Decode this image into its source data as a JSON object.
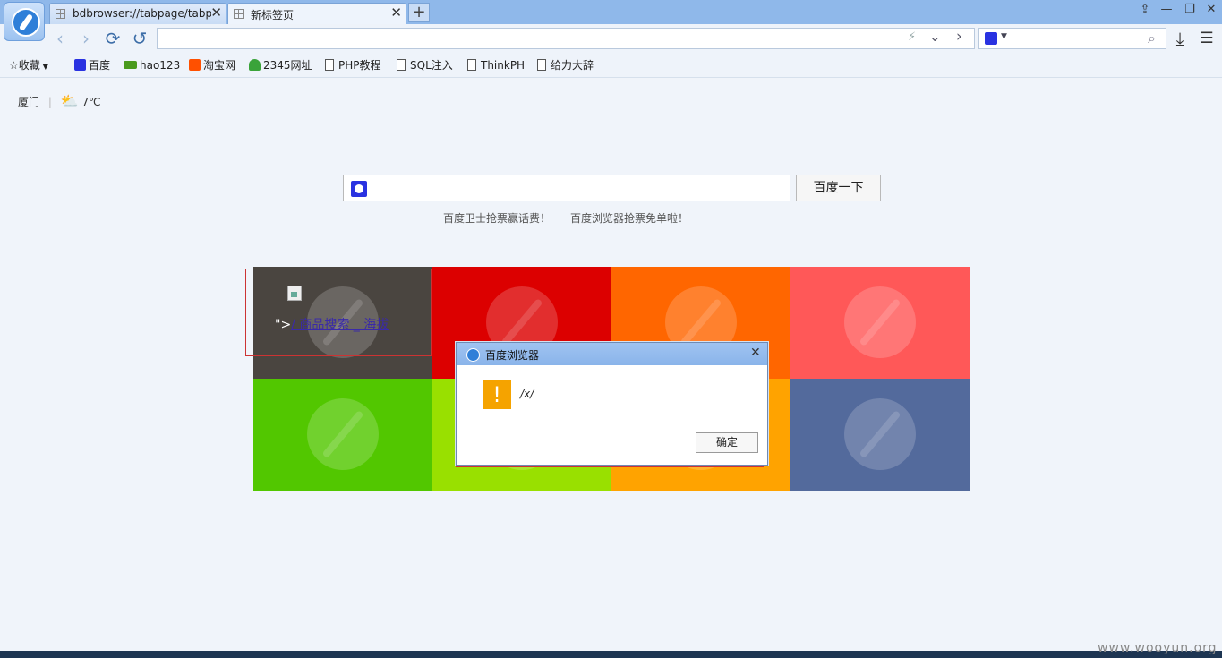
{
  "tabs": [
    {
      "title": "bdbrowser://tabpage/tabpa",
      "active": false
    },
    {
      "title": "新标签页",
      "active": true
    }
  ],
  "tab_close_glyph": "✕",
  "new_tab_glyph": "+",
  "window_controls": {
    "skin": "⇪",
    "minimize": "—",
    "maximize": "❐",
    "close": "✕"
  },
  "nav": {
    "back": "‹",
    "forward": "›",
    "refresh": "⟳",
    "undo": "↺",
    "url_value": "",
    "flash": "⚡",
    "dropdown": "⌄",
    "go": "›",
    "search_value": "",
    "search_icon": "⌕",
    "download": "⤓",
    "menu": "☰"
  },
  "bookmarks": {
    "favorites_label": "收藏",
    "items": [
      {
        "label": "百度",
        "icon": "baidu-paw-icon",
        "color": "#2932e1"
      },
      {
        "label": "hao123",
        "icon": "hao123-icon",
        "color": "#4a9a1e"
      },
      {
        "label": "淘宝网",
        "icon": "taobao-icon",
        "color": "#ff5000"
      },
      {
        "label": "2345网址",
        "icon": "2345-icon",
        "color": "#3aa33a"
      },
      {
        "label": "PHP教程",
        "icon": "page-icon"
      },
      {
        "label": "SQL注入",
        "icon": "page-icon"
      },
      {
        "label": "ThinkPH",
        "icon": "page-icon"
      },
      {
        "label": "给力大辞",
        "icon": "page-icon"
      }
    ]
  },
  "weather": {
    "city": "厦门",
    "temperature": "7℃"
  },
  "search": {
    "button_label": "百度一下",
    "value": ""
  },
  "hints": [
    "百度卫士抢票赢话费！",
    "百度浏览器抢票免单啦！"
  ],
  "tiles": [
    {
      "color": "#4a4540"
    },
    {
      "color": "#dc0000"
    },
    {
      "color": "#ff6600"
    },
    {
      "color": "#ff5858"
    },
    {
      "color": "#52c700"
    },
    {
      "color": "#99e000"
    },
    {
      "color": "#ffa300"
    },
    {
      "color": "#536a9c"
    }
  ],
  "injected_link": {
    "prefix": "\">",
    "text": "/ 商品搜索 _ 海拔"
  },
  "dialog": {
    "title": "百度浏览器",
    "message": "/x/",
    "ok_label": "确定",
    "warning_glyph": "!",
    "close_glyph": "✕"
  },
  "watermark": "www.wooyun.org"
}
